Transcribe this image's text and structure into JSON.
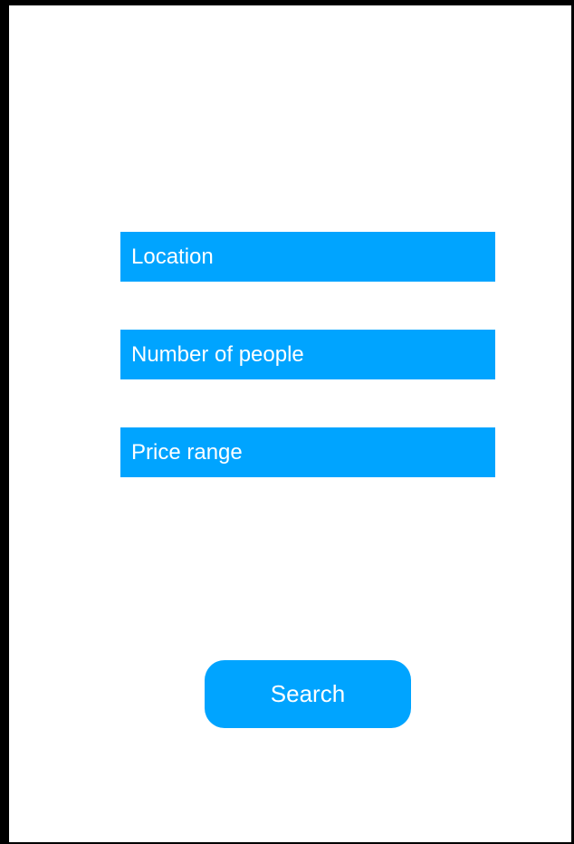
{
  "form": {
    "fields": [
      {
        "placeholder": "Location"
      },
      {
        "placeholder": "Number of people"
      },
      {
        "placeholder": "Price range"
      }
    ],
    "search_label": "Search"
  },
  "colors": {
    "accent": "#00a4ff",
    "frame": "#000000",
    "background": "#ffffff",
    "text_on_accent": "#ffffff"
  }
}
